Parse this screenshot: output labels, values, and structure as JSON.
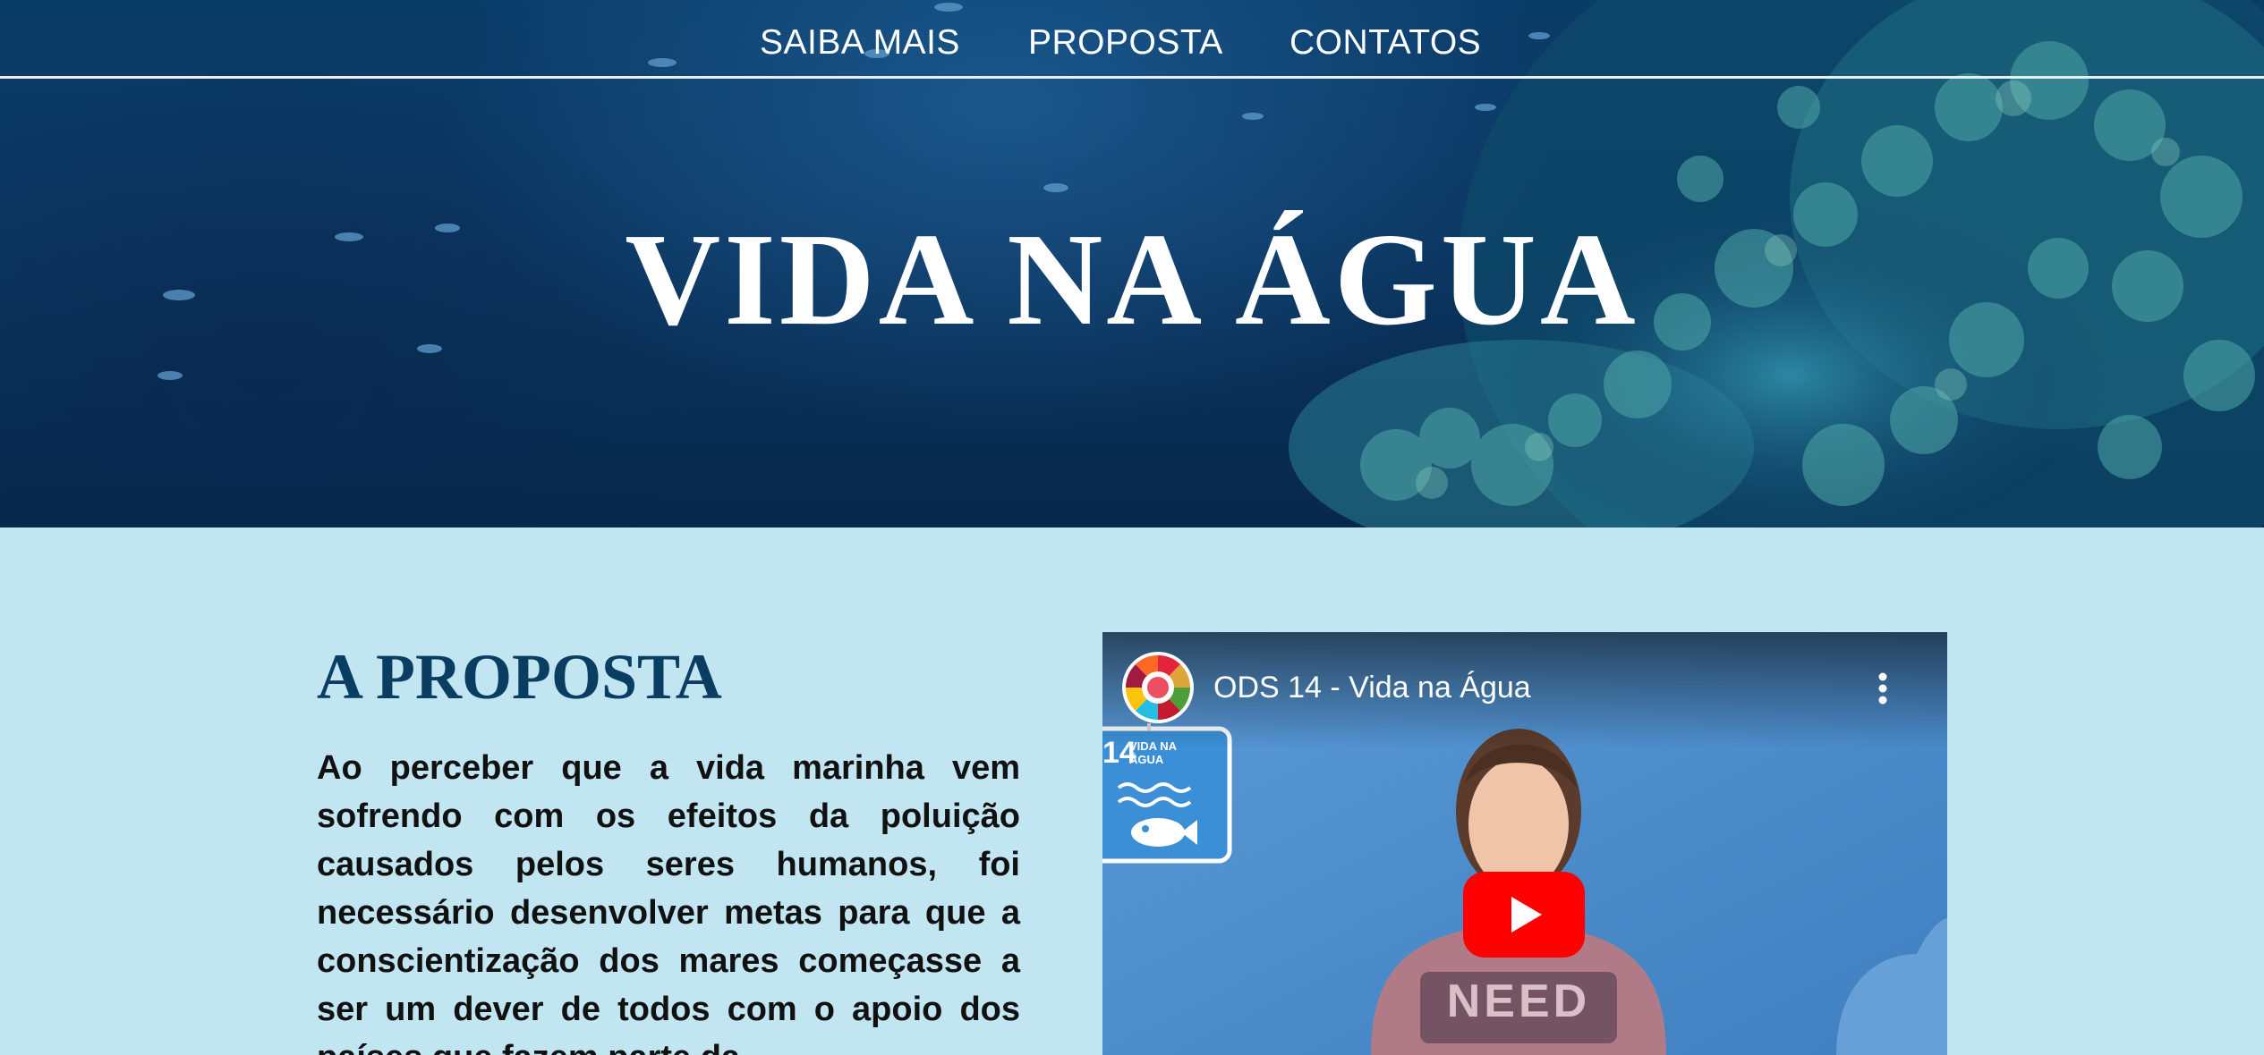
{
  "nav": {
    "items": [
      {
        "label": "SAIBA MAIS"
      },
      {
        "label": "PROPOSTA"
      },
      {
        "label": "CONTATOS"
      }
    ]
  },
  "hero": {
    "title": "VIDA NA ÁGUA"
  },
  "proposal": {
    "heading": "A PROPOSTA",
    "body": "Ao perceber que a vida marinha vem sofrendo com os efeitos da poluição causados pelos seres humanos, foi necessário desenvolver metas para que a conscientização dos mares começasse a ser um dever de todos com o apoio dos países que fazem parte da"
  },
  "video": {
    "title": "ODS 14 - Vida na Água",
    "sign_number": "14",
    "sign_line1": "VIDA NA",
    "sign_line2": "ÁGUA",
    "shirt_text": "NEED",
    "play_icon": "play-icon",
    "menu_icon": "more-vertical-icon"
  },
  "colors": {
    "page_background": "#c1e5f1",
    "heading": "#0a3d62",
    "youtube_red": "#ff0000"
  }
}
